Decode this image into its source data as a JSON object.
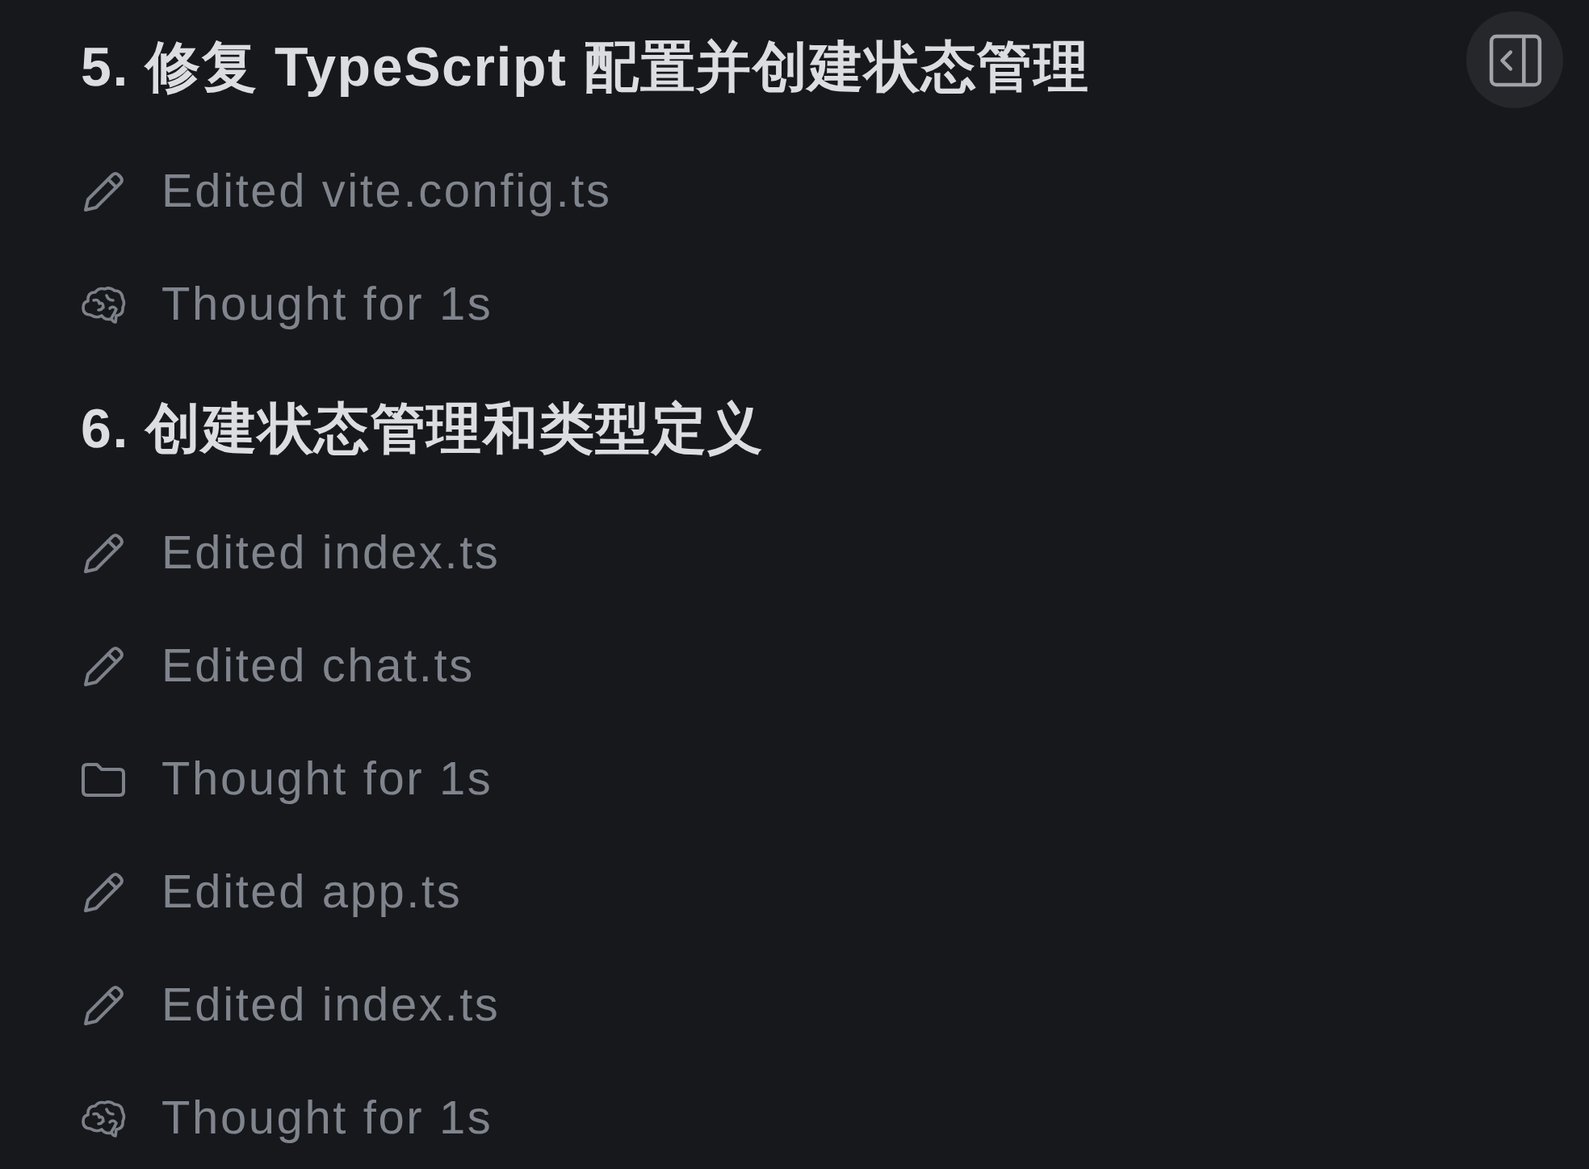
{
  "sidebar_toggle": {
    "kind": "collapse"
  },
  "sections": [
    {
      "title": "5. 修复 TypeScript 配置并创建状态管理",
      "steps": [
        {
          "kind": "edit",
          "label": "Edited vite.config.ts"
        },
        {
          "kind": "thought",
          "label": "Thought for 1s"
        }
      ]
    },
    {
      "title": "6. 创建状态管理和类型定义",
      "steps": [
        {
          "kind": "edit",
          "label": "Edited index.ts"
        },
        {
          "kind": "edit",
          "label": "Edited chat.ts"
        },
        {
          "kind": "folder",
          "label": "Thought for 1s"
        },
        {
          "kind": "edit",
          "label": "Edited app.ts"
        },
        {
          "kind": "edit",
          "label": "Edited index.ts"
        },
        {
          "kind": "thought",
          "label": "Thought for 1s"
        }
      ]
    }
  ]
}
